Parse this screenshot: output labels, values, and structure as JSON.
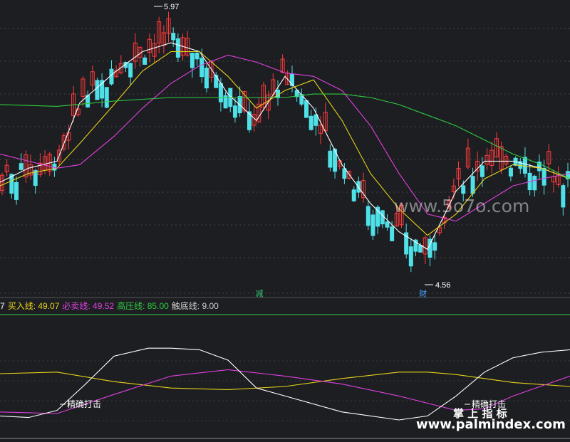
{
  "chart_data": [
    {
      "type": "candlestick",
      "panel": "main",
      "price_range": [
        4.4,
        6.0
      ],
      "annotations": {
        "high_label": "5.97",
        "low_label": "4.56"
      },
      "signals": [
        {
          "label": "减",
          "color": "#2ecc71",
          "at": 0.455
        },
        {
          "label": "财",
          "color": "#4aa3ff",
          "at": 0.742
        }
      ],
      "series": [
        {
          "name": "MA-white",
          "color": "#ffffff",
          "x": [
            0,
            0.05,
            0.1,
            0.14,
            0.2,
            0.25,
            0.3,
            0.35,
            0.4,
            0.45,
            0.5,
            0.55,
            0.6,
            0.65,
            0.7,
            0.75,
            0.8,
            0.85,
            0.9,
            0.95,
            1.0
          ],
          "y": [
            5.0,
            5.08,
            5.12,
            5.45,
            5.62,
            5.74,
            5.79,
            5.74,
            5.5,
            5.35,
            5.6,
            5.42,
            5.1,
            4.88,
            4.72,
            4.62,
            4.95,
            5.12,
            5.12,
            5.08,
            5.02
          ]
        },
        {
          "name": "MA-yellow",
          "color": "#e6d21a",
          "x": [
            0,
            0.05,
            0.1,
            0.14,
            0.2,
            0.25,
            0.3,
            0.35,
            0.4,
            0.45,
            0.5,
            0.55,
            0.6,
            0.65,
            0.7,
            0.75,
            0.8,
            0.85,
            0.9,
            0.95,
            1.0
          ],
          "y": [
            4.98,
            5.05,
            5.08,
            5.22,
            5.44,
            5.63,
            5.74,
            5.74,
            5.6,
            5.42,
            5.52,
            5.58,
            5.35,
            5.05,
            4.85,
            4.7,
            4.82,
            5.02,
            5.1,
            5.08,
            5.02
          ]
        },
        {
          "name": "MA-magenta",
          "color": "#e040e0",
          "x": [
            0,
            0.05,
            0.1,
            0.14,
            0.2,
            0.25,
            0.3,
            0.35,
            0.4,
            0.45,
            0.5,
            0.55,
            0.6,
            0.65,
            0.7,
            0.75,
            0.8,
            0.85,
            0.9,
            0.95,
            1.0
          ],
          "y": [
            5.16,
            5.12,
            5.08,
            5.1,
            5.26,
            5.42,
            5.56,
            5.66,
            5.72,
            5.68,
            5.62,
            5.6,
            5.52,
            5.32,
            5.05,
            4.82,
            4.78,
            4.88,
            4.98,
            5.02,
            5.05
          ]
        },
        {
          "name": "MA-green",
          "color": "#2ecc40",
          "x": [
            0,
            0.1,
            0.2,
            0.3,
            0.4,
            0.5,
            0.55,
            0.6,
            0.65,
            0.7,
            0.75,
            0.8,
            0.85,
            0.9,
            0.95,
            1.0
          ],
          "y": [
            5.44,
            5.43,
            5.46,
            5.48,
            5.48,
            5.48,
            5.5,
            5.5,
            5.48,
            5.44,
            5.38,
            5.32,
            5.24,
            5.16,
            5.1,
            5.02
          ]
        }
      ]
    },
    {
      "type": "line",
      "panel": "indicator",
      "legend": [
        {
          "text": "7",
          "color": "#ffffff"
        },
        {
          "text": "买入线: 49.07",
          "color": "#e6d21a"
        },
        {
          "text": "必卖线: 49.52",
          "color": "#e040e0"
        },
        {
          "text": "高压线: 85.00",
          "color": "#2ecc40"
        },
        {
          "text": "触底线: 9.00",
          "color": "#cccccc"
        }
      ],
      "ylim": [
        0,
        100
      ],
      "labels": [
        {
          "text": "精确打击",
          "at": 0.12
        },
        {
          "text": "精确打击",
          "at": 0.83
        }
      ],
      "series": [
        {
          "name": "",
          "color": "#e6d21a",
          "x": [
            0,
            0.1,
            0.2,
            0.3,
            0.4,
            0.5,
            0.6,
            0.7,
            0.75,
            0.8,
            0.9,
            1.0
          ],
          "y": [
            58,
            60,
            48,
            40,
            38,
            42,
            52,
            60,
            60,
            57,
            47,
            42
          ]
        },
        {
          "name": "",
          "color": "#e040e0",
          "x": [
            0,
            0.1,
            0.2,
            0.3,
            0.4,
            0.5,
            0.6,
            0.7,
            0.8,
            0.85,
            0.9,
            1.0
          ],
          "y": [
            10,
            8,
            32,
            55,
            63,
            55,
            45,
            30,
            12,
            14,
            30,
            55
          ]
        },
        {
          "name": "",
          "color": "#ffffff",
          "x": [
            0,
            0.05,
            0.1,
            0.15,
            0.2,
            0.26,
            0.3,
            0.35,
            0.4,
            0.45,
            0.5,
            0.6,
            0.7,
            0.75,
            0.8,
            0.85,
            0.9,
            0.95,
            1.0
          ],
          "y": [
            5,
            3,
            12,
            45,
            80,
            90,
            90,
            88,
            75,
            40,
            30,
            10,
            0,
            5,
            30,
            60,
            78,
            85,
            88
          ]
        }
      ]
    }
  ],
  "watermarks": {
    "top": "www.5o7o.com",
    "brand": "掌 上 指 标",
    "url": "www.palmindex.com"
  }
}
